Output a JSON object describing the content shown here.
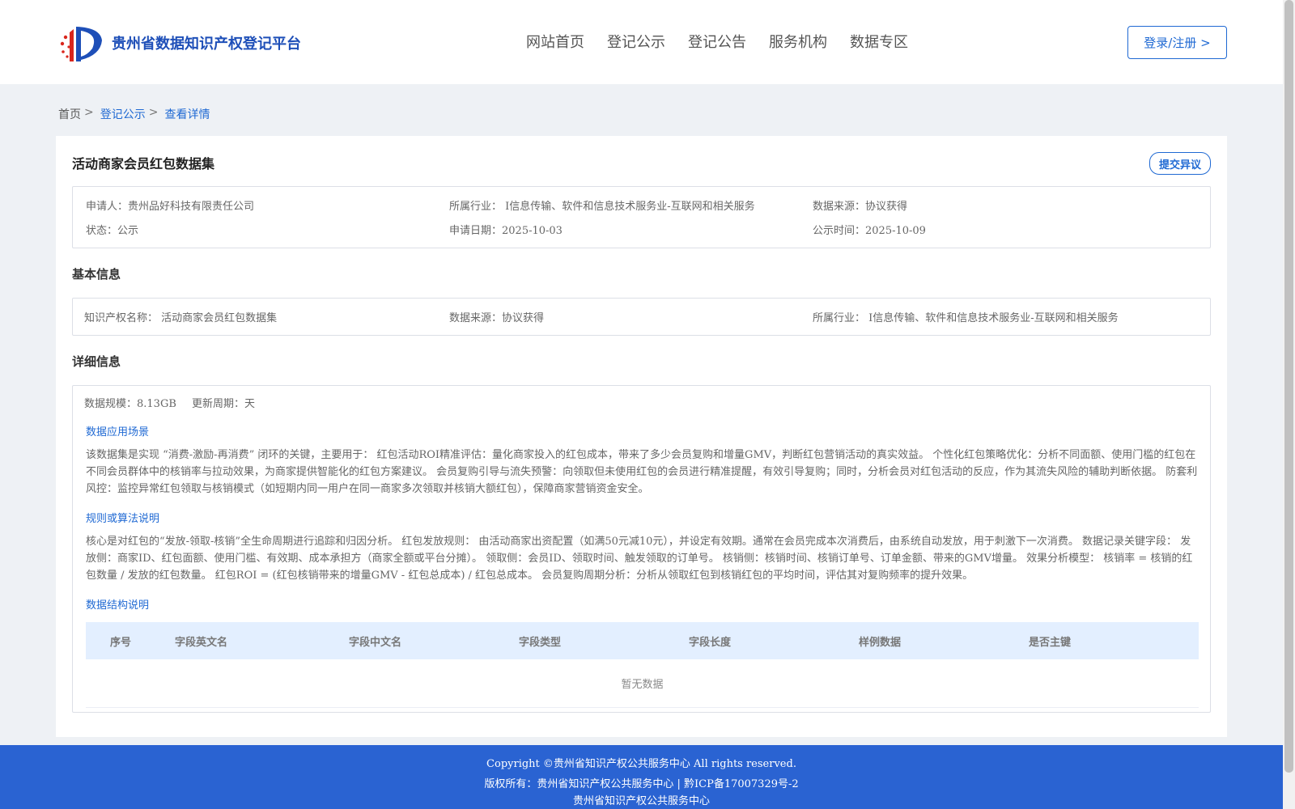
{
  "header": {
    "brand": "贵州省数据知识产权登记平台",
    "nav": [
      "网站首页",
      "登记公示",
      "登记公告",
      "服务机构",
      "数据专区"
    ],
    "login": "登录/注册 >"
  },
  "breadcrumb": {
    "home": "首页",
    "sep": ">",
    "items": [
      "登记公示",
      "查看详情"
    ]
  },
  "detail": {
    "title": "活动商家会员红包数据集",
    "objection_button": "提交异议",
    "summary": {
      "applicant": "申请人：贵州品好科技有限责任公司",
      "industry": "所属行业： I信息传输、软件和信息技术服务业-互联网和相关服务",
      "source": "数据来源：协议获得",
      "status": "状态：公示",
      "apply_date": "申请日期：2025-10-03",
      "publish_date": "公示时间：2025-10-09"
    },
    "basic": {
      "heading": "基本信息",
      "ip_name": "知识产权名称： 活动商家会员红包数据集",
      "source": "数据来源：协议获得",
      "industry": "所属行业： I信息传输、软件和信息技术服务业-互联网和相关服务"
    },
    "details": {
      "heading": "详细信息",
      "scale": "数据规模：8.13GB",
      "cycle": "更新周期：天",
      "scenario_title": "数据应用场景",
      "scenario_text": "该数据集是实现 “消费-激励-再消费” 闭环的关键，主要用于： 红包活动ROI精准评估：量化商家投入的红包成本，带来了多少会员复购和增量GMV，判断红包营销活动的真实效益。 个性化红包策略优化：分析不同面额、使用门槛的红包在不同会员群体中的核销率与拉动效果，为商家提供智能化的红包方案建议。 会员复购引导与流失预警：向领取但未使用红包的会员进行精准提醒，有效引导复购；同时，分析会员对红包活动的反应，作为其流失风险的辅助判断依据。 防套利风控：监控异常红包领取与核销模式（如短期内同一用户在同一商家多次领取并核销大额红包），保障商家营销资金安全。",
      "rules_title": "规则或算法说明",
      "rules_text": "核心是对红包的“发放-领取-核销”全生命周期进行追踪和归因分析。 红包发放规则： 由活动商家出资配置（如满50元减10元），并设定有效期。通常在会员完成本次消费后，由系统自动发放，用于刺激下一次消费。 数据记录关键字段： 发放侧：商家ID、红包面额、使用门槛、有效期、成本承担方（商家全额或平台分摊）。 领取侧：会员ID、领取时间、触发领取的订单号。 核销侧：核销时间、核销订单号、订单金额、带来的GMV增量。 效果分析模型： 核销率 = 核销的红包数量 / 发放的红包数量。 红包ROI = (红包核销带来的增量GMV - 红包总成本) / 红包总成本。 会员复购周期分析：分析从领取红包到核销红包的平均时间，评估其对复购频率的提升效果。",
      "structure_title": "数据结构说明",
      "table_headers": [
        "序号",
        "字段英文名",
        "字段中文名",
        "字段类型",
        "字段长度",
        "样例数据",
        "是否主键"
      ],
      "table_empty": "暂无数据"
    }
  },
  "footer": {
    "copyright": "Copyright ©贵州省知识产权公共服务中心 All rights reserved.",
    "owner": "版权所有：贵州省知识产权公共服务中心 | 黔ICP备17007329号-2",
    "org": "贵州省知识产权公共服务中心"
  }
}
